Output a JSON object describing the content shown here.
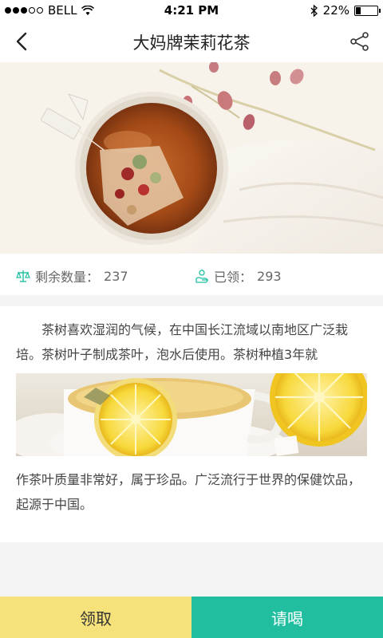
{
  "status_bar": {
    "carrier": "BELL",
    "time": "4:21 PM",
    "battery_percent": "22%",
    "battery_level": 0.22,
    "signal_strength": 3,
    "signal_max": 5
  },
  "nav": {
    "title": "大妈牌茉莉花茶",
    "back_icon": "chevron-left-icon",
    "share_icon": "share-icon"
  },
  "stats": {
    "remaining_label": "剩余数量：",
    "remaining_value": "237",
    "claimed_label": "已领：",
    "claimed_value": "293",
    "icon_color": "#21bfa0"
  },
  "content": {
    "paragraph1": "茶树喜欢湿润的气候，在中国长江流域以南地区广泛栽培。茶树叶子制成茶叶，泡水后使用。茶树种植3年就",
    "paragraph2": "作茶叶质量非常好，属于珍品。广泛流行于世界的保健饮品，起源于中国。"
  },
  "footer": {
    "receive_label": "领取",
    "drink_label": "请喝",
    "receive_color": "#f5e27a",
    "drink_color": "#21bfa0"
  }
}
